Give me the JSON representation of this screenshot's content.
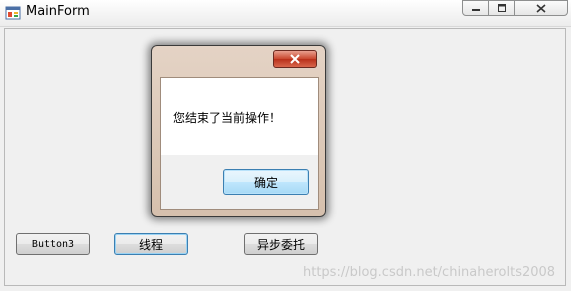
{
  "window": {
    "title": "MainForm",
    "icon": "app-form-icon",
    "controls": [
      "minimize-icon",
      "maximize-icon",
      "close-icon"
    ]
  },
  "form": {
    "button3_label": "Button3",
    "thread_label": "线程",
    "async_delegate_label": "异步委托"
  },
  "dialog": {
    "message": "您结束了当前操作！",
    "ok_label": "确定",
    "close_icon": "close-icon"
  },
  "watermark": "https://blog.csdn.net/chinaherolts2008",
  "colors": {
    "dialog_frame": "#d6c0ad",
    "close_button": "#c9462d",
    "focus_border": "#3c7fb1"
  }
}
